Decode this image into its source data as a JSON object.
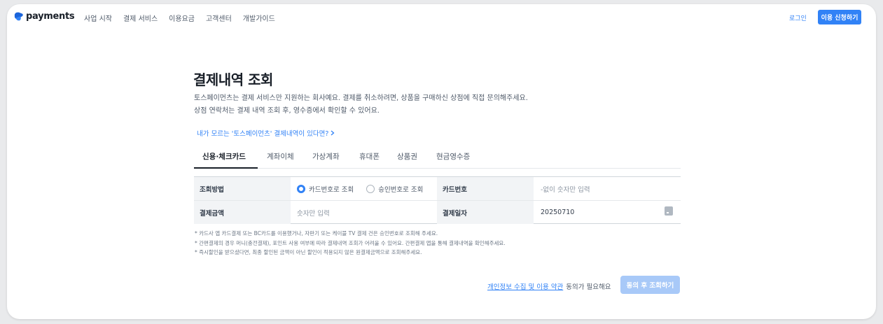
{
  "header": {
    "logo_text": "payments",
    "nav": [
      "사업 시작",
      "결제 서비스",
      "이용요금",
      "고객센터",
      "개발가이드"
    ],
    "login_label": "로그인",
    "apply_label": "이용 신청하기"
  },
  "main": {
    "title": "결제내역 조회",
    "description_line1": "토스페이먼츠는 결제 서비스만 지원하는 회사예요. 결제를 취소하려면, 상품을 구매하신 상점에 직접 문의해주세요.",
    "description_line2": "상점 연락처는 결제 내역 조회 후, 영수증에서 확인할 수 있어요.",
    "help_link": "내가 모르는 '토스페이먼츠' 결제내역이 있다면?",
    "tabs": [
      "신용·체크카드",
      "계좌이체",
      "가상계좌",
      "휴대폰",
      "상품권",
      "현금영수증"
    ],
    "active_tab": "신용·체크카드"
  },
  "form": {
    "method_label": "조회방법",
    "method_options": [
      "카드번호로 조회",
      "승인번호로 조회"
    ],
    "method_selected": "카드번호로 조회",
    "card_number_label": "카드번호",
    "card_number_placeholder": "-없이 숫자만 입력",
    "amount_label": "결제금액",
    "amount_placeholder": "숫자만 입력",
    "date_label": "결제일자",
    "date_value": "20250710"
  },
  "notes": [
    "* 카드사 앱 카드결제 또는 BC카드를 이용했거나, 자판기 또는 케이블 TV 결제 건은 승인번호로 조회해 주세요.",
    "* 간편결제의 경우 머니(충전결제), 포인트 사용 여부에 따라 결제내역 조회가 어려울 수 있어요. 간편결제 앱을 통해 결제내역을 확인해주세요.",
    "* 즉시할인을 받으셨다면, 최종 할인된 금액이 아닌 할인이 적용되지 않은 원결제금액으로 조회해주세요."
  ],
  "footer": {
    "agree_link": "개인정보 수집 및 이용 약관",
    "agree_text": "동의가 필요해요",
    "submit_label": "동의 후 조회하기"
  },
  "colors": {
    "accent": "#3182f6",
    "submit_disabled": "#a8c9f8",
    "table_header_bg": "#f2f4f6"
  }
}
